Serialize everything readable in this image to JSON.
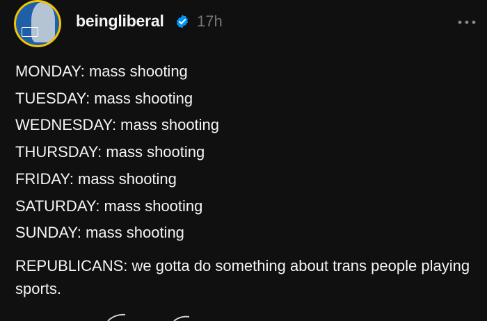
{
  "post": {
    "username": "beingliberal",
    "timestamp": "17h",
    "avatar_icon": "campaign-portrait-avatar",
    "verified_icon": "verified-badge-icon",
    "more_icon": "more-horizontal-icon",
    "lines": [
      "MONDAY: mass shooting",
      "TUESDAY: mass shooting",
      "WEDNESDAY: mass shooting",
      "THURSDAY: mass shooting",
      "FRIDAY: mass shooting",
      "SATURDAY: mass shooting",
      "SUNDAY: mass shooting"
    ],
    "closing": "REPUBLICANS: we gotta do something about trans people playing sports."
  },
  "colors": {
    "background": "#101010",
    "text": "#f3f5f7",
    "muted": "#777777",
    "verified": "#0095f6",
    "avatar_ring": "#f2c500"
  }
}
